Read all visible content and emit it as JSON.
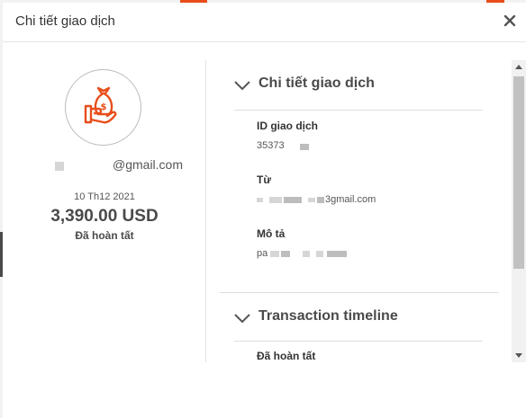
{
  "modal": {
    "title": "Chi tiết giao dịch",
    "close_icon": "close-icon"
  },
  "summary": {
    "avatar_icon": "money-bag-hand-icon",
    "email_suffix": "@gmail.com",
    "date": "10 Th12 2021",
    "amount": "3,390.00 USD",
    "status": "Đã hoàn tất"
  },
  "details": {
    "section_title": "Chi tiết giao dịch",
    "transaction_id_label": "ID giao dịch",
    "transaction_id_value": "35373",
    "from_label": "Từ",
    "from_value_suffix": "3gmail.com",
    "description_label": "Mô tả",
    "description_value_prefix": "pa"
  },
  "timeline": {
    "section_title": "Transaction timeline",
    "first_status": "Đã hoàn tất"
  },
  "colors": {
    "accent": "#e84e1b",
    "text_dark": "#4a4a4a"
  }
}
